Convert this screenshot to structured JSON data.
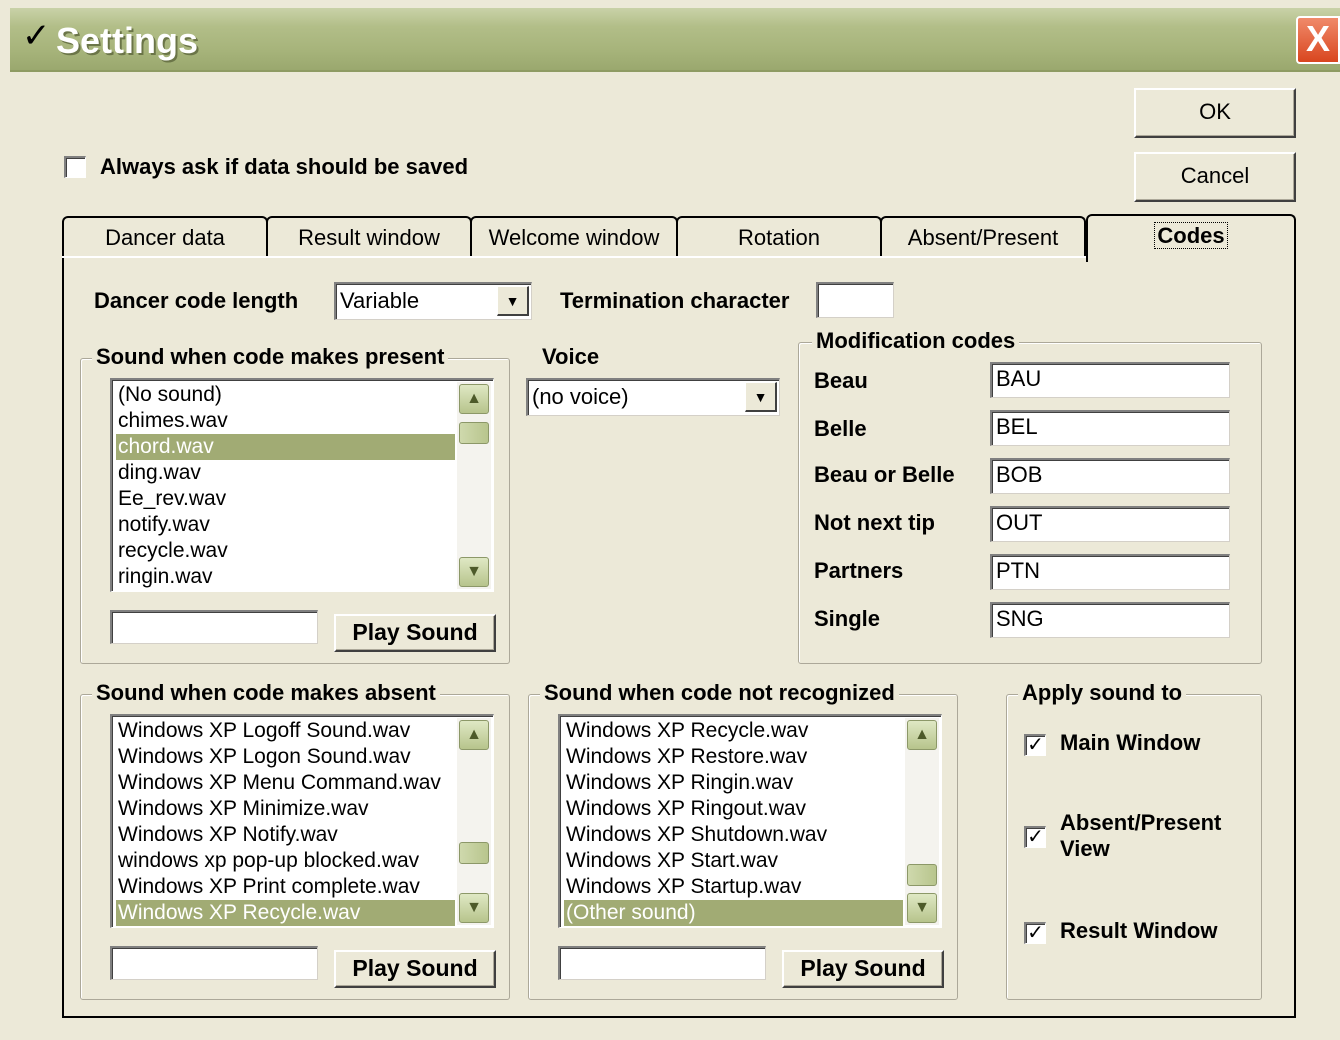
{
  "window": {
    "title": "Settings",
    "check_glyph": "✓",
    "close_glyph": "X"
  },
  "buttons": {
    "ok": "OK",
    "cancel": "Cancel"
  },
  "always_ask": {
    "label": "Always ask if data should be saved",
    "checked": false
  },
  "tabs": [
    {
      "label": "Dancer data",
      "active": false
    },
    {
      "label": "Result window",
      "active": false
    },
    {
      "label": "Welcome window",
      "active": false
    },
    {
      "label": "Rotation",
      "active": false
    },
    {
      "label": "Absent/Present",
      "active": false
    },
    {
      "label": "Codes",
      "active": true
    }
  ],
  "codes": {
    "dancer_code_length_label": "Dancer code length",
    "dancer_code_length_value": "Variable",
    "termination_label": "Termination character",
    "termination_value": "",
    "voice_label": "Voice",
    "voice_value": "(no voice)",
    "present": {
      "label": "Sound when code makes present",
      "items": [
        "(No sound)",
        "chimes.wav",
        "chord.wav",
        "ding.wav",
        "Ee_rev.wav",
        "notify.wav",
        "recycle.wav",
        "ringin.wav"
      ],
      "selected_index": 2,
      "field_value": "",
      "play_label": "Play Sound"
    },
    "absent": {
      "label": "Sound when code makes absent",
      "items": [
        "Windows XP Logoff Sound.wav",
        "Windows XP Logon Sound.wav",
        "Windows XP Menu Command.wav",
        "Windows XP Minimize.wav",
        "Windows XP Notify.wav",
        "windows xp pop-up blocked.wav",
        "Windows XP Print complete.wav",
        "Windows XP Recycle.wav"
      ],
      "selected_index": 7,
      "field_value": "",
      "play_label": "Play Sound"
    },
    "not_recognized": {
      "label": "Sound when code not recognized",
      "items": [
        "Windows XP Recycle.wav",
        "Windows XP Restore.wav",
        "Windows XP Ringin.wav",
        "Windows XP Ringout.wav",
        "Windows XP Shutdown.wav",
        "Windows XP Start.wav",
        "Windows XP Startup.wav",
        "(Other sound)"
      ],
      "selected_index": 7,
      "field_value": "",
      "play_label": "Play Sound"
    },
    "modification": {
      "label": "Modification codes",
      "rows": [
        {
          "label": "Beau",
          "value": "BAU"
        },
        {
          "label": "Belle",
          "value": "BEL"
        },
        {
          "label": "Beau or Belle",
          "value": "BOB"
        },
        {
          "label": "Not next tip",
          "value": "OUT"
        },
        {
          "label": "Partners",
          "value": "PTN"
        },
        {
          "label": "Single",
          "value": "SNG"
        }
      ]
    },
    "apply": {
      "label": "Apply sound to",
      "main_window": {
        "label": "Main Window",
        "checked": true
      },
      "absent_present": {
        "label": "Absent/Present View",
        "checked": true
      },
      "result_window": {
        "label": "Result Window",
        "checked": true
      }
    }
  },
  "icons": {
    "check": "✓",
    "dropdown": "▼",
    "scroll_up": "▲",
    "scroll_down": "▼"
  }
}
